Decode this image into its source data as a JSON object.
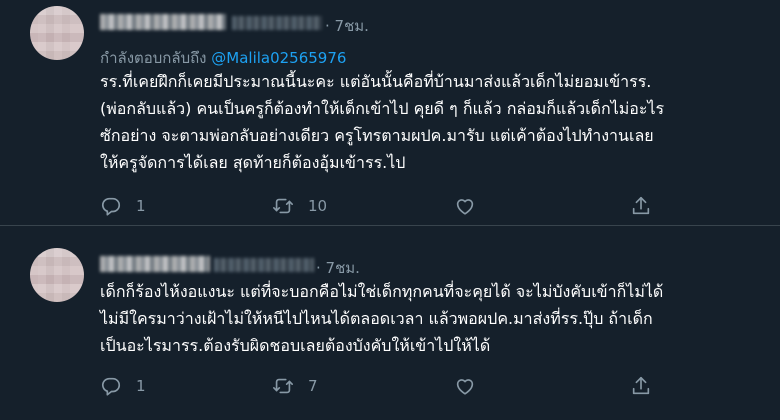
{
  "tweets": [
    {
      "time": "· 7ชม.",
      "replying_prefix": "กำลังตอบกลับถึง ",
      "replying_handle": "@Malila02565976",
      "lines": [
        "รร.ที่เคยฝึกก็เคยมีประมาณนี้นะคะ แต่อันนั้นคือที่บ้านมาส่งแล้วเด็กไม่ยอมเข้ารร.",
        "(พ่อกลับแล้ว) คนเป็นครูก็ต้องทำให้เด็กเข้าไป คุยดี ๆ ก็แล้ว กล่อมก็แล้วเด็กไม่อะไร",
        "ซักอย่าง จะตามพ่อกลับอย่างเดียว ครูโทรตามผปค.มารับ แต่เค้าต้องไปทำงานเลย",
        "ให้ครูจัดการได้เลย สุดท้ายก็ต้องอุ้มเข้ารร.ไป"
      ],
      "replies": "1",
      "retweets": "10",
      "likes": ""
    },
    {
      "time": "· 7ชม.",
      "lines": [
        "เด็กก็ร้องไห้งอแงนะ แต่ที่จะบอกคือไม่ใช่เด็กทุกคนที่จะคุยได้ จะไม่บังคับเข้าก็ไม่ได้",
        "ไม่มีใครมาว่างเฝ้าไม่ให้หนีไปไหนได้ตลอดเวลา แล้วพอผปค.มาส่งที่รร.ปุ๊บ ถ้าเด็ก",
        "เป็นอะไรมารร.ต้องรับผิดชอบเลยต้องบังคับให้เข้าไปให้ได้"
      ],
      "replies": "1",
      "retweets": "7",
      "likes": ""
    }
  ],
  "icons": {
    "reply": "reply-icon",
    "retweet": "retweet-icon",
    "like": "like-icon",
    "share": "share-icon"
  },
  "colors": {
    "background": "#15202b",
    "secondary_text": "#8899a6",
    "link": "#1da1f2",
    "divider": "#38444d"
  }
}
